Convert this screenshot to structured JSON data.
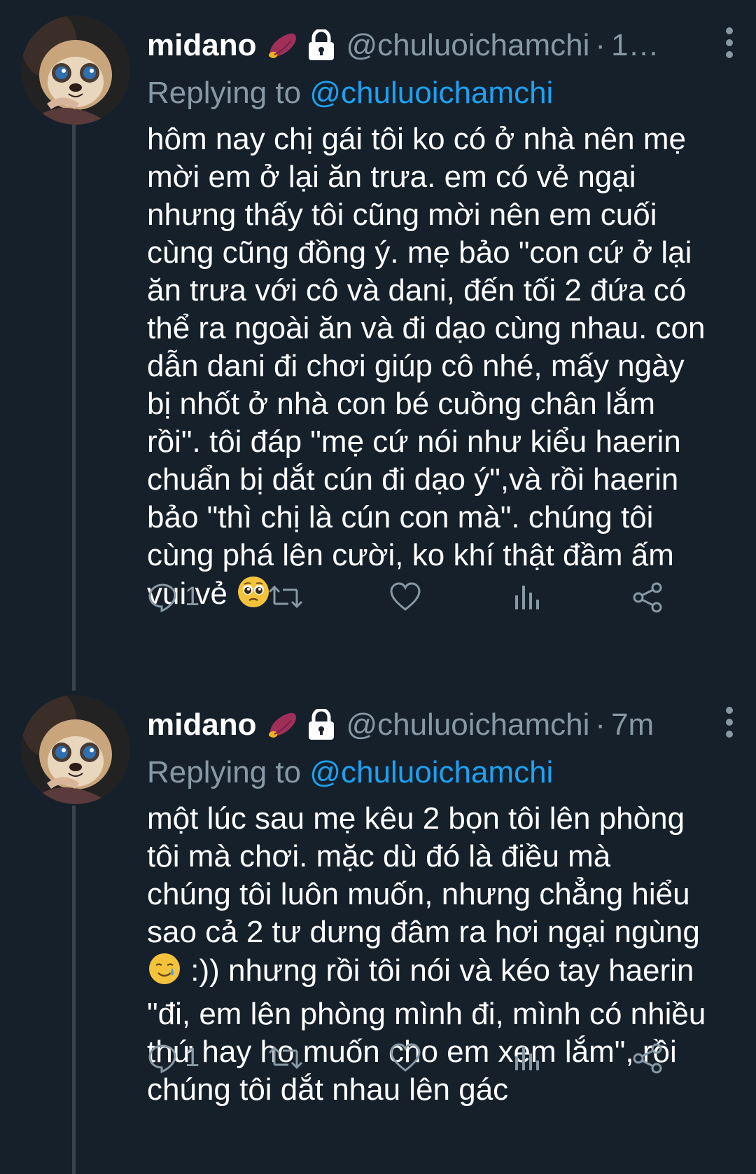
{
  "colors": {
    "background": "#15202b",
    "text": "#ffffff",
    "muted": "#8899a6",
    "link": "#1da1f2",
    "thread_line": "#38444d"
  },
  "tweets": [
    {
      "name": "midano",
      "handle": "@chuluoichamchi",
      "time": "1…",
      "replying_prefix": "Replying to",
      "replying_to": "@chuluoichamchi",
      "body_lines": [
        "hôm nay chị gái tôi ko có ở nhà nên mẹ",
        "mời em ở lại ăn trưa. em có vẻ ngại",
        "nhưng thấy tôi cũng mời nên em cuối",
        "cùng cũng đồng ý. mẹ bảo \"con cứ ở lại",
        "ăn trưa với cô và dani, đến tối 2 đứa có",
        "thể ra ngoài ăn và đi dạo cùng nhau. con",
        "dẫn dani đi chơi giúp cô nhé, mấy ngày",
        "bị nhốt ở nhà con bé cuồng chân lắm",
        "rồi\". tôi đáp \"mẹ cứ nói như kiểu haerin",
        "chuẩn bị dắt cún đi dạo ý\",và rồi haerin",
        "bảo \"thì chị là cún con mà\". chúng tôi",
        "cùng phá lên cười, ko khí thật đầm ấm",
        "vui vẻ"
      ],
      "end_emoji": "pleading-face-emoji",
      "reply_count": "1"
    },
    {
      "name": "midano",
      "handle": "@chuluoichamchi",
      "time": "7m",
      "replying_prefix": "Replying to",
      "replying_to": "@chuluoichamchi",
      "body_lines": [
        "một lúc sau mẹ kêu 2 bọn tôi lên phòng",
        "tôi mà chơi. mặc dù đó là điều mà",
        "chúng tôi luôn muốn, nhưng chẳng hiểu",
        "sao cả 2 tư dưng đâm ra hơi ngại ngùng",
        ":)) nhưng rồi tôi nói và kéo tay haerin",
        "\"đi, em lên phòng mình đi, mình có nhiều",
        "thứ hay ho muốn cho em xem lắm\", rồi",
        "chúng tôi dắt nhau lên gác"
      ],
      "start_emoji": "smiling-face-with-tear-emoji",
      "reply_count": "1"
    }
  ],
  "icons": {
    "name_emoji": "sweet-potato-emoji",
    "lock": "lock-icon",
    "more": "more-vertical-icon",
    "reply": "reply-icon",
    "retweet": "retweet-icon",
    "like": "heart-icon",
    "analytics": "analytics-icon",
    "share": "share-icon"
  }
}
